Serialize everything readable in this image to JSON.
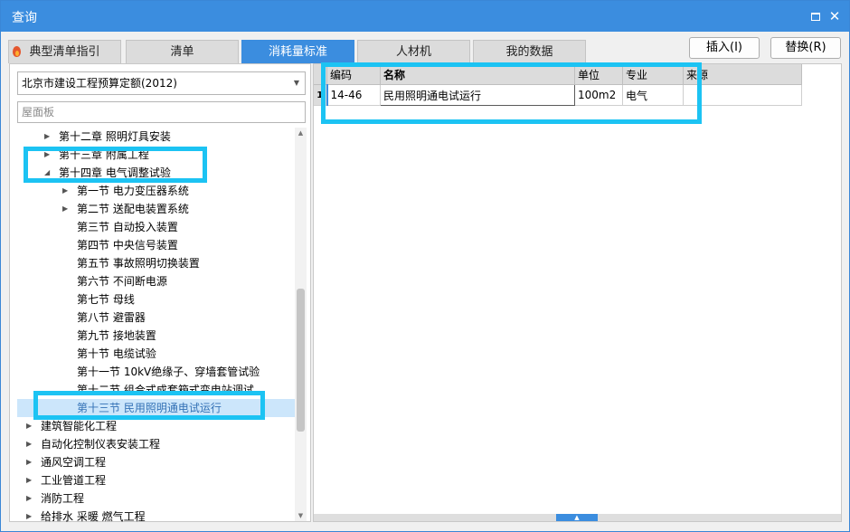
{
  "window": {
    "title": "查询"
  },
  "tabs": [
    {
      "label": "典型清单指引",
      "active": false
    },
    {
      "label": "清单",
      "active": false
    },
    {
      "label": "消耗量标准",
      "active": true
    },
    {
      "label": "人材机",
      "active": false
    },
    {
      "label": "我的数据",
      "active": false
    }
  ],
  "actions": {
    "insert": "插入(I)",
    "replace": "替换(R)"
  },
  "left": {
    "quota_select": "北京市建设工程预算定额(2012)",
    "search_placeholder": "屋面板",
    "tree": [
      {
        "label": "第十二章 照明灯具安装",
        "expander": "collapsed"
      },
      {
        "label": "第十三章 附属工程",
        "expander": "collapsed"
      },
      {
        "label": "第十四章 电气调整试验",
        "expander": "expanded"
      },
      {
        "label": "第一节 电力变压器系统",
        "expander": "collapsed"
      },
      {
        "label": "第二节 送配电装置系统",
        "expander": "collapsed"
      },
      {
        "label": "第三节 自动投入装置",
        "expander": "none"
      },
      {
        "label": "第四节 中央信号装置",
        "expander": "none"
      },
      {
        "label": "第五节 事故照明切换装置",
        "expander": "none"
      },
      {
        "label": "第六节 不间断电源",
        "expander": "none"
      },
      {
        "label": "第七节 母线",
        "expander": "none"
      },
      {
        "label": "第八节 避雷器",
        "expander": "none"
      },
      {
        "label": "第九节 接地装置",
        "expander": "none"
      },
      {
        "label": "第十节 电缆试验",
        "expander": "none"
      },
      {
        "label": "第十一节 10kV绝缘子、穿墙套管试验",
        "expander": "none"
      },
      {
        "label": "第十二节 组合式成套箱式变电站调试",
        "expander": "none"
      },
      {
        "label": "第十三节 民用照明通电试运行",
        "expander": "none",
        "selected": true
      },
      {
        "label": "建筑智能化工程",
        "expander": "collapsed"
      },
      {
        "label": "自动化控制仪表安装工程",
        "expander": "collapsed"
      },
      {
        "label": "通风空调工程",
        "expander": "collapsed"
      },
      {
        "label": "工业管道工程",
        "expander": "collapsed"
      },
      {
        "label": "消防工程",
        "expander": "collapsed"
      },
      {
        "label": "给排水 采暖 燃气工程",
        "expander": "collapsed"
      }
    ]
  },
  "grid": {
    "headers": {
      "code": "编码",
      "name": "名称",
      "unit": "单位",
      "discipline": "专业",
      "source": "来源"
    },
    "rows": [
      {
        "index": "1",
        "code": "14-46",
        "name": "民用照明通电试运行",
        "unit": "100m2",
        "discipline": "电气",
        "source": ""
      }
    ]
  },
  "colors": {
    "accent": "#3b8ddf",
    "highlight": "#1cc3f3",
    "selected_row": "#cce6fb"
  }
}
